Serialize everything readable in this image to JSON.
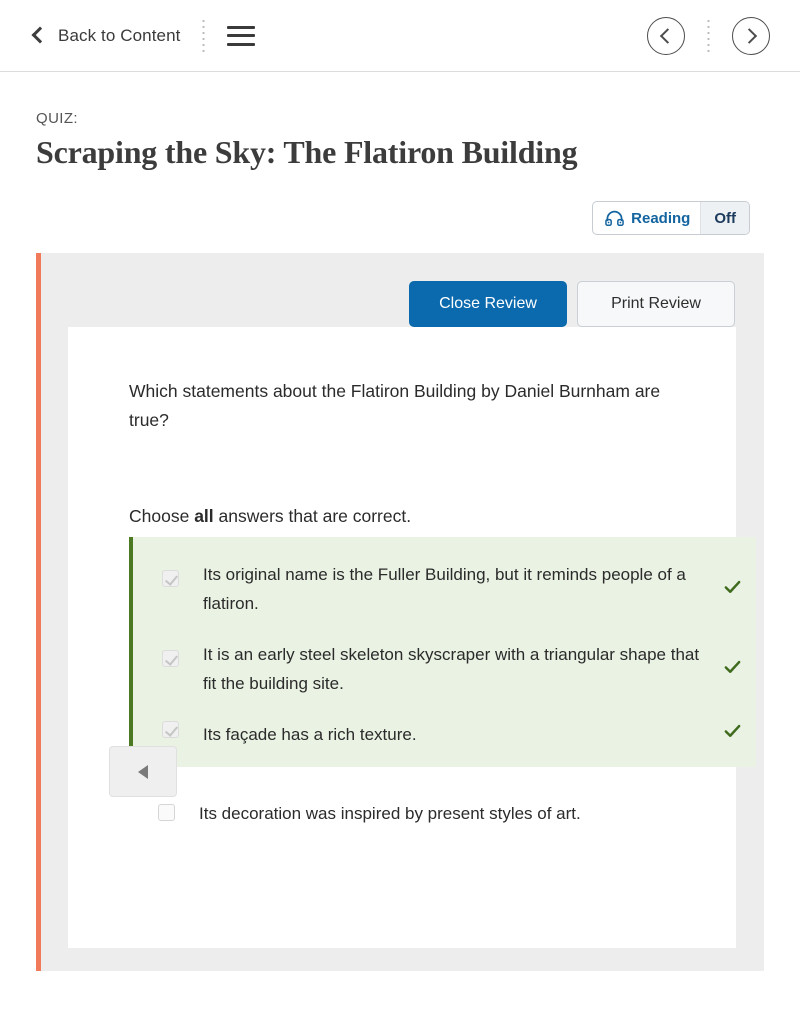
{
  "topbar": {
    "back_label": "Back to Content",
    "back_chevron_icon": "chevron-left-icon",
    "menu_icon": "hamburger-menu-icon",
    "divider_icon": "dotted-divider",
    "prev_icon": "circle-chevron-left-icon",
    "next_icon": "circle-chevron-right-icon"
  },
  "header": {
    "kicker": "QUIZ:",
    "title": "Scraping the Sky: The Flatiron Building"
  },
  "reading_toggle": {
    "icon": "headphones-icon",
    "label": "Reading",
    "state": "Off",
    "accent_color": "#1464a0"
  },
  "review": {
    "accent_bar_color": "#f07a5a",
    "close_review_label": "Close Review",
    "print_review_label": "Print Review",
    "primary_color": "#0b69ad"
  },
  "question": {
    "prompt": "Which statements about the Flatiron Building by Daniel Burnham are true?",
    "instruction_prefix": "Choose ",
    "instruction_emphasis": "all",
    "instruction_suffix": " answers that are correct.",
    "correct_group_bg": "#e9f2e3",
    "correct_group_border": "#4b7a22",
    "tick_color": "#3f6b1e",
    "options": [
      {
        "text": "Its original name is the Fuller Building, but it reminds people of a flatiron.",
        "checked": true,
        "correct": true
      },
      {
        "text": "It is an early steel skeleton skyscraper with a triangular shape that fit the building site.",
        "checked": true,
        "correct": true
      },
      {
        "text": "Its façade has a rich texture.",
        "checked": true,
        "correct": true
      },
      {
        "text": "Its decoration was inspired by present styles of art.",
        "checked": false,
        "correct": false
      }
    ]
  },
  "footer_nav": {
    "prev_icon": "triangle-left-icon"
  }
}
